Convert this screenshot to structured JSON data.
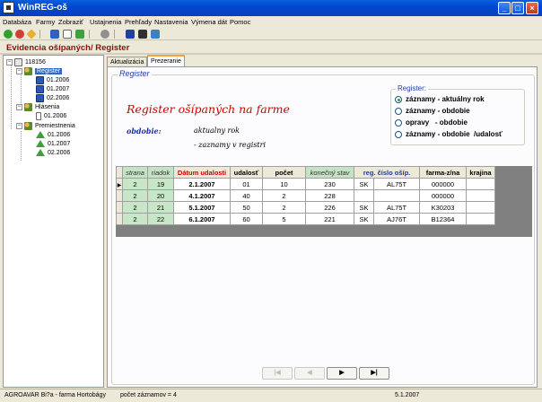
{
  "window": {
    "title": "WinREG-oš"
  },
  "menu": [
    "Databáza",
    "Farmy",
    "Zobraziť",
    "Ustajnenia",
    "Prehľady",
    "Nastavenia",
    "Výmena dát",
    "Pomoc"
  ],
  "header": {
    "title": "Evidencia ošípaných/ Register"
  },
  "tree": {
    "root": "118156",
    "register": {
      "label": "Register",
      "items": [
        "01.2006",
        "01.2007",
        "02.2006"
      ]
    },
    "hlasenia": {
      "label": "Hlásenia",
      "items": [
        "01.2006"
      ]
    },
    "premiestnenia": {
      "label": "Premiestnenia",
      "items": [
        "01.2006",
        "01.2007",
        "02.2006"
      ]
    }
  },
  "tabs": [
    "Aktualizácia",
    "Prezeranie"
  ],
  "panel": {
    "group_title": "Register",
    "main_title": "Register ošípaných na farme",
    "obdobie_label": "obdobie:",
    "obdobie_value": "aktualny rok",
    "obdobie_sub": "- zaznamy v registri"
  },
  "register_options": {
    "legend": "Register:",
    "options": [
      "záznamy - aktuálny rok",
      "záznamy - obdobie",
      "opravy   - obdobie",
      "záznamy - obdobie  /udalosť"
    ],
    "selected_index": 0
  },
  "grid": {
    "headers": [
      "strana",
      "riadok",
      "Dátum udalosti",
      "udalosť",
      "počet",
      "konečný stav",
      "reg. číslo ošíp.",
      "farma-z/na",
      "krajina"
    ],
    "rows": [
      [
        "2",
        "19",
        "2.1.2007",
        "01",
        "10",
        "230",
        "SK",
        "AL75T",
        "000000",
        ""
      ],
      [
        "2",
        "20",
        "4.1.2007",
        "40",
        "2",
        "228",
        "",
        "",
        "000000",
        ""
      ],
      [
        "2",
        "21",
        "5.1.2007",
        "50",
        "2",
        "226",
        "SK",
        "AL75T",
        "K30203",
        ""
      ],
      [
        "2",
        "22",
        "6.1.2007",
        "60",
        "5",
        "221",
        "SK",
        "AJ76T",
        "B12364",
        ""
      ]
    ]
  },
  "nav": {
    "first": "|◀",
    "prev": "◀",
    "next": "▶",
    "last": "▶|"
  },
  "status": {
    "farm": "AGROAVAR Bi?a - farma Hortobágy",
    "count": "počet záznamov = 4",
    "date": "5.1.2007"
  }
}
